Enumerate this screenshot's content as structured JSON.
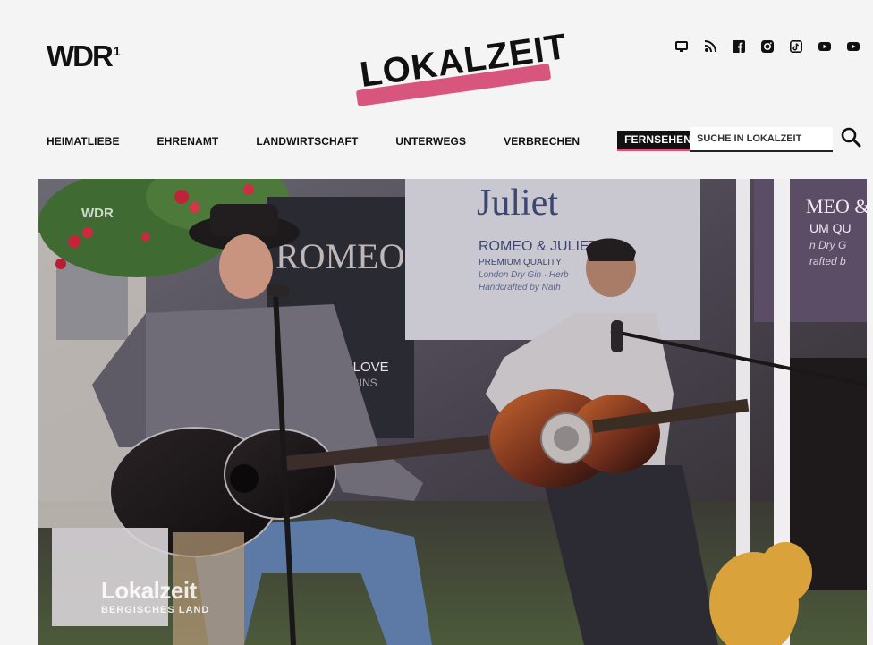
{
  "header": {
    "wdr_logo": "WDR",
    "wdr_logo_mark": "1",
    "brand": "LOKALZEIT"
  },
  "social": [
    "tv-icon",
    "rss-icon",
    "facebook-icon",
    "instagram-icon",
    "tiktok-icon",
    "youtube-icon",
    "youtube-icon"
  ],
  "nav": {
    "items": [
      "HEIMATLIEBE",
      "EHRENAMT",
      "LANDWIRTSCHAFT",
      "UNTERWEGS",
      "VERBRECHEN",
      "FERNSEHEN"
    ],
    "active": "FERNSEHEN"
  },
  "search": {
    "placeholder": "SUCHE IN LOKALZEIT"
  },
  "hero": {
    "overlay_wdr": "WDR",
    "overlay_title": "Lokalzeit",
    "overlay_subtitle": "BERGISCHES LAND",
    "banner_top": "Juliet",
    "banner_brand": "ROMEO & JULIET",
    "banner_line1": "PREMIUM QUALITY",
    "banner_line2": "London Dry Gin · Herb",
    "banner_line3": "Handcrafted by Nath",
    "sign_left": "ROMEO",
    "sign_love": "ONE LOVE",
    "sign_love2": "TWO GINS",
    "right_sign": "MEO &",
    "right_sign2": "UM QU",
    "right_sign3": "n Dry G",
    "right_sign4": "rafted b"
  },
  "colors": {
    "accent": "#d8567e",
    "text": "#111111",
    "background": "#f4f4f4"
  }
}
